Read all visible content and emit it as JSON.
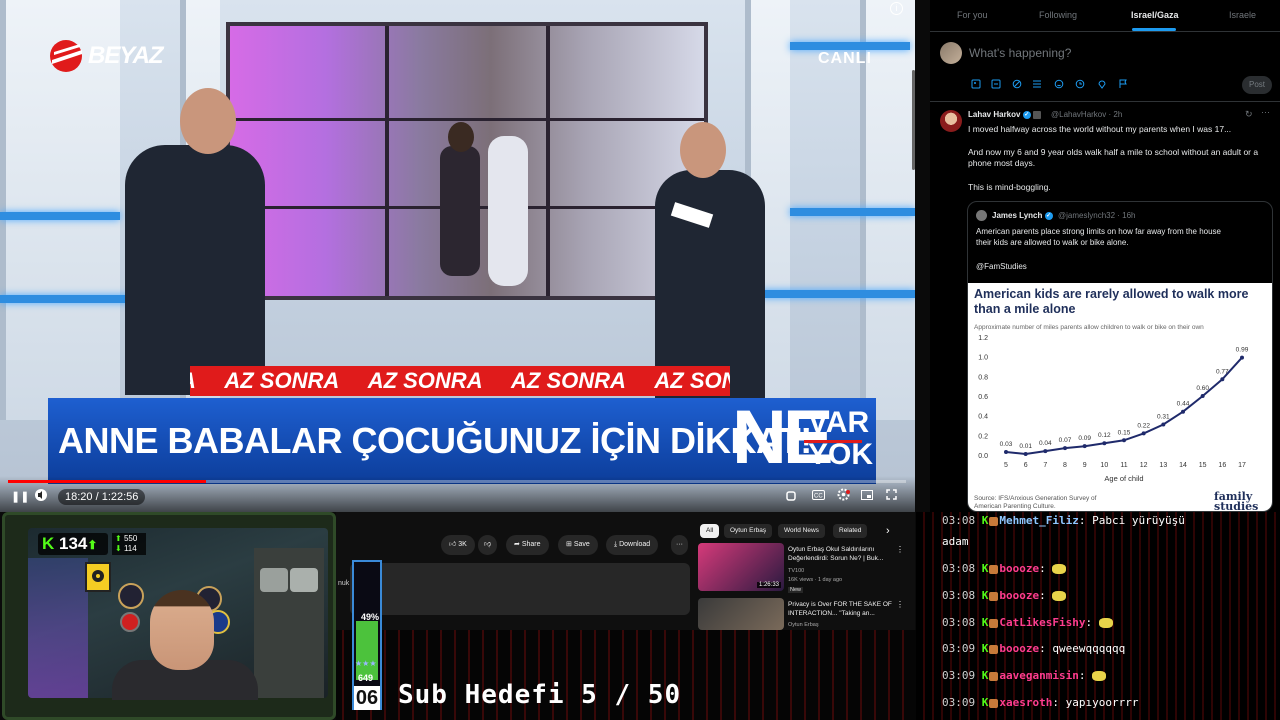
{
  "broadcast": {
    "channel_logo": "BEYAZ",
    "live_label": "CANLI",
    "ticker_items": [
      "AZ SONRA",
      "AZ SONRA",
      "AZ SONRA",
      "AZ SONRA"
    ],
    "headline": "ANNE BABALAR ÇOCUĞUNUZ İÇİN DİKKAT!",
    "program_ne": "NE",
    "program_var": "VAR",
    "program_yok": "YOK"
  },
  "player": {
    "time": "18:20 / 1:22:56",
    "progress": 0.22,
    "play_icon": "pause-icon",
    "volume_icon": "volume-icon",
    "right_icons": [
      "autoplay-icon",
      "subtitles-icon",
      "settings-icon",
      "miniplayer-icon",
      "fullscreen-icon"
    ],
    "info_icon": "info-icon"
  },
  "twitter": {
    "tabs": [
      "For you",
      "Following",
      "Israel/Gaza",
      "Israele"
    ],
    "active_tab": "Israel/Gaza",
    "compose_placeholder": "What's happening?",
    "post_label": "Post",
    "compose_icons": [
      "image-icon",
      "gif-icon",
      "grok-icon",
      "list-icon",
      "emoji-icon",
      "schedule-icon",
      "location-icon",
      "flag-icon"
    ],
    "tweet": {
      "name": "Lahav Harkov",
      "handle": "@LahavHarkov · 2h",
      "lines": [
        "I moved halfway across the world without my parents when I was 17...",
        "And now my 6 and 9 year olds walk half a mile to school without an adult or a",
        "phone most days.",
        "This is mind-boggling."
      ]
    },
    "quote": {
      "name": "James Lynch",
      "handle": "@jameslynch32 · 16h",
      "lines": [
        "American parents place strong limits on how far away from the house",
        "their kids are allowed to walk or bike alone.",
        "@FamStudies"
      ]
    }
  },
  "chart_data": {
    "type": "line",
    "title": "American kids are rarely allowed to walk more than a mile alone",
    "subtitle": "Approximate number of miles parents allow children to walk or bike on their own",
    "xlabel": "Age of child",
    "ylabel": "",
    "x": [
      5,
      6,
      7,
      8,
      9,
      10,
      11,
      12,
      13,
      14,
      15,
      16,
      17
    ],
    "values": [
      0.03,
      0.01,
      0.04,
      0.07,
      0.09,
      0.12,
      0.15,
      0.22,
      0.31,
      0.44,
      0.6,
      0.77,
      0.99
    ],
    "labels": [
      "0.03",
      "0.01",
      "0.04",
      "0.07",
      "0.09",
      "0.12",
      "0.15",
      "0.22",
      "0.31",
      "0.44",
      "0.60",
      "0.77",
      "0.99"
    ],
    "ylim": [
      0,
      1.2
    ],
    "yticks": [
      "0.0",
      "0.2",
      "0.4",
      "0.6",
      "0.8",
      "1.0",
      "1.2"
    ],
    "grid": false,
    "color": "#1f2a6b",
    "source": "Source: IFS/Anxious Generation Survey of American Parenting Culture.",
    "logo": "family studies"
  },
  "webcam": {
    "follower_count": "134",
    "stat_top": "550",
    "stat_bottom": "114"
  },
  "youtube": {
    "actions": [
      {
        "icon": "thumbs-up-icon",
        "label": "3K"
      },
      {
        "icon": "thumbs-down-icon",
        "label": ""
      },
      {
        "icon": "share-icon",
        "label": "Share"
      },
      {
        "icon": "save-icon",
        "label": "Save"
      },
      {
        "icon": "download-icon",
        "label": "Download"
      }
    ],
    "chips": [
      "All",
      "Oytun Erbaş",
      "World News",
      "Related"
    ],
    "desc_fragment": "nuk",
    "recommendations": [
      {
        "title": "Oytun Erbaş Okul Saldırılarını Değerlendirdi: Sorun Ne? | Buk...",
        "channel": "TV100",
        "meta": "16K views · 1 day ago",
        "badge": "New",
        "duration": "1:26:33"
      },
      {
        "title": "Privacy is Over FOR THE SAKE OF INTERACTION... \"Taking an...",
        "channel": "Oytun Erbaş",
        "meta": "",
        "badge": "",
        "duration": ""
      }
    ]
  },
  "overlay": {
    "sub_goal": "Sub Hedefi 5 / 50",
    "meter_percent": "49%",
    "meter_fraction": 0.49,
    "meter_count": "649",
    "meter_number": "06"
  },
  "chat": [
    {
      "time": "03:08",
      "user": "Mehmet_Filiz",
      "msg": "Pabci yürüyüşü",
      "color": "cyan"
    },
    {
      "time": "",
      "user": "",
      "msg": "adam",
      "color": ""
    },
    {
      "time": "03:08",
      "user": "boooze",
      "msg": "",
      "color": "pink",
      "emote": true
    },
    {
      "time": "03:08",
      "user": "boooze",
      "msg": "",
      "color": "pink",
      "emote": true
    },
    {
      "time": "03:08",
      "user": "CatLikesFishy",
      "msg": "",
      "color": "pink",
      "emote": true
    },
    {
      "time": "03:09",
      "user": "boooze",
      "msg": "qweewqqqqqq",
      "color": "pink"
    },
    {
      "time": "03:09",
      "user": "aaveganmisin",
      "msg": "",
      "color": "pink",
      "emote": true
    },
    {
      "time": "03:09",
      "user": "xaesroth",
      "msg": "yapıyoorrrr",
      "color": "pink"
    }
  ]
}
